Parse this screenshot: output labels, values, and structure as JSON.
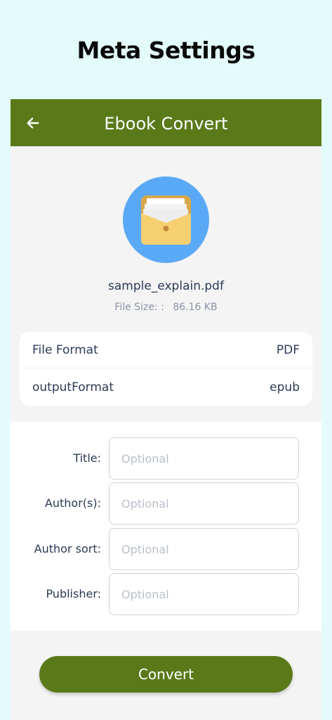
{
  "page": {
    "heading": "Meta Settings"
  },
  "app_bar": {
    "back_icon": "arrow-left-icon",
    "title": "Ebook Convert"
  },
  "file": {
    "icon": "folder-document-icon",
    "name": "sample_explain.pdf",
    "size_label": "File Size: :",
    "size_value": "86.16 KB"
  },
  "info": {
    "rows": [
      {
        "label": "File Format",
        "value": "PDF"
      },
      {
        "label": "outputFormat",
        "value": "epub"
      }
    ]
  },
  "form": {
    "fields": [
      {
        "label": "Title:",
        "placeholder": "Optional",
        "value": ""
      },
      {
        "label": "Author(s):",
        "placeholder": "Optional",
        "value": ""
      },
      {
        "label": "Author sort:",
        "placeholder": "Optional",
        "value": ""
      },
      {
        "label": "Publisher:",
        "placeholder": "Optional",
        "value": ""
      }
    ]
  },
  "actions": {
    "convert_label": "Convert"
  },
  "colors": {
    "background": "#e3fbfb",
    "accent": "#5a7a1a",
    "avatar": "#5aa9f6",
    "folder": "#f5cc6a"
  }
}
